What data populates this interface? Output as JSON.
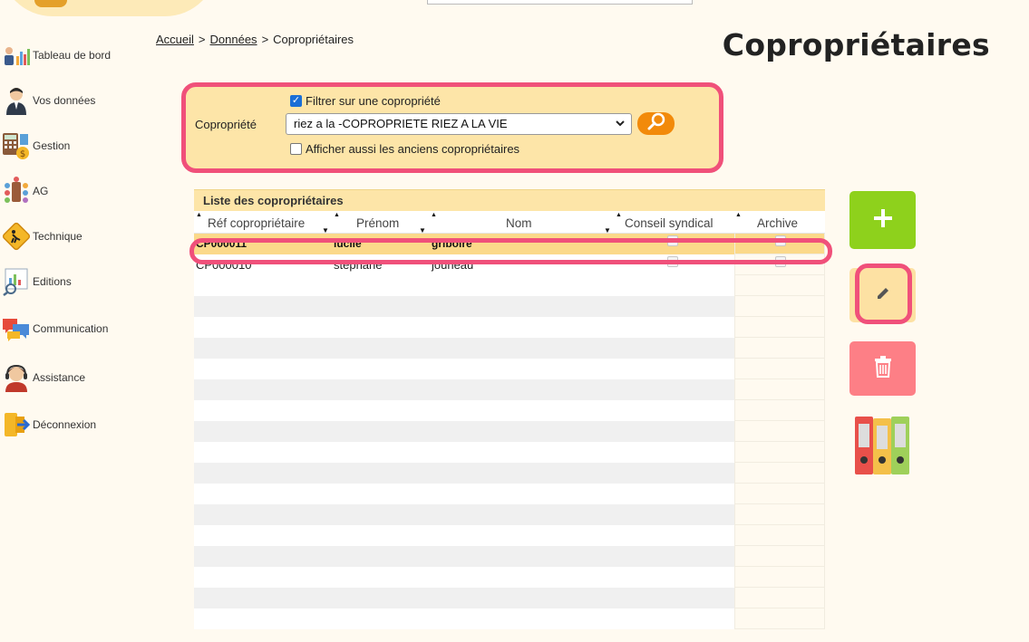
{
  "breadcrumb": {
    "home": "Accueil",
    "sep1": ">",
    "data": "Données",
    "sep2": ">",
    "current": "Copropriétaires"
  },
  "page_title": "Copropriétaires",
  "sidebar": {
    "items": [
      {
        "label": "Tableau de bord",
        "icon": "dashboard-chart-icon"
      },
      {
        "label": "Vos données",
        "icon": "user-icon"
      },
      {
        "label": "Gestion",
        "icon": "calculator-icon"
      },
      {
        "label": "AG",
        "icon": "meeting-icon"
      },
      {
        "label": "Technique",
        "icon": "roadwork-sign-icon"
      },
      {
        "label": "Editions",
        "icon": "report-icon"
      },
      {
        "label": "Communication",
        "icon": "chat-bubbles-icon"
      },
      {
        "label": "Assistance",
        "icon": "headset-icon"
      },
      {
        "label": "Déconnexion",
        "icon": "logout-icon"
      }
    ]
  },
  "filter": {
    "filter_checkbox_label": "Filtrer sur une copropriété",
    "filter_checked": true,
    "copro_label": "Copropriété",
    "copro_selected": "riez a la -COPROPRIETE RIEZ A LA VIE",
    "show_old_label": "Afficher aussi les anciens copropriétaires",
    "show_old_checked": false
  },
  "table": {
    "caption": "Liste des copropriétaires",
    "columns": [
      "Réf copropriétaire",
      "Prénom",
      "Nom",
      "Conseil syndical",
      "Archive"
    ],
    "rows": [
      {
        "ref": "CP000011",
        "prenom": "lucile",
        "nom": "griboire",
        "conseil": false,
        "archive": false,
        "selected": true
      },
      {
        "ref": "CP000010",
        "prenom": "stephane",
        "nom": "jouneau",
        "conseil": false,
        "archive": false,
        "selected": false
      }
    ]
  },
  "actions": [
    "add-icon",
    "edit-pencil-icon",
    "trash-icon",
    "binders-icon"
  ],
  "colors": {
    "accent_pink": "#f0507a",
    "panel_yellow": "#fde5a8",
    "add_green": "#8ed11c",
    "delete_red": "#fd7f86",
    "search_orange": "#f28a0a"
  }
}
